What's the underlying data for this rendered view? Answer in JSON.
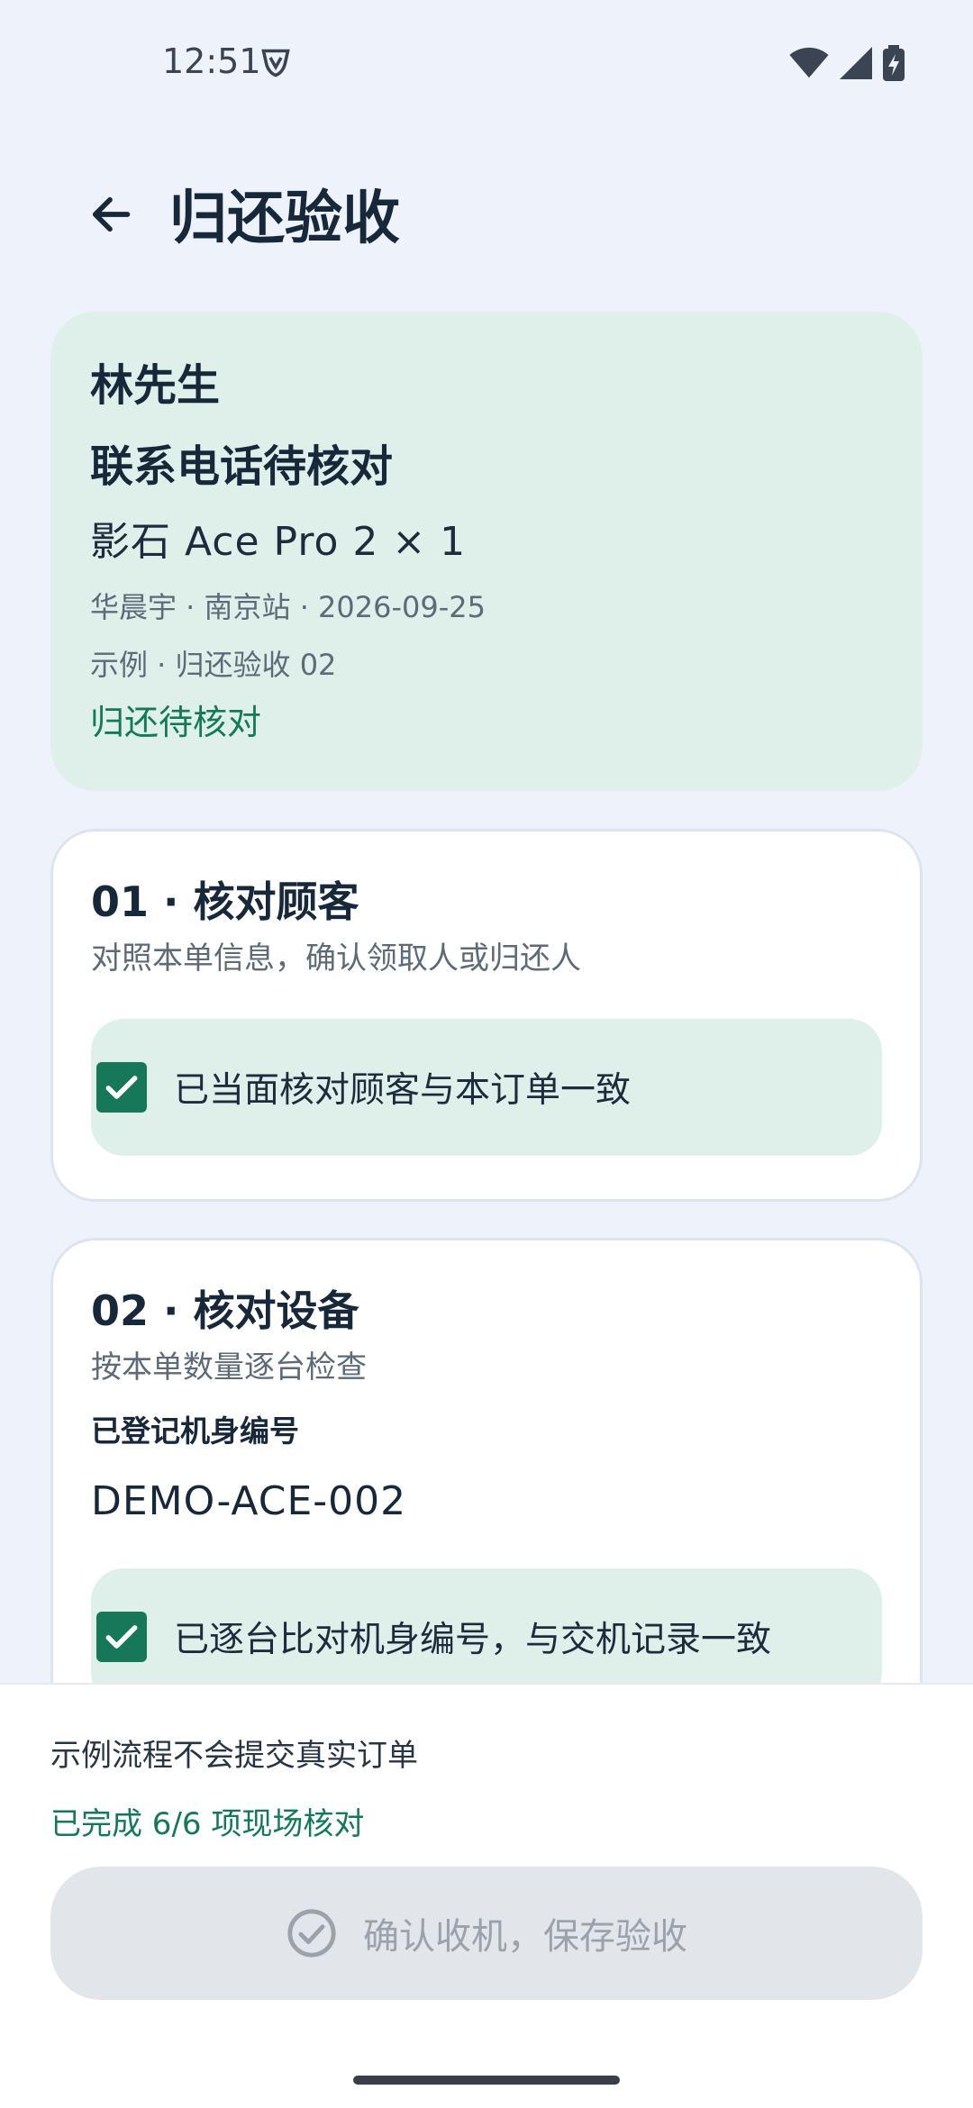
{
  "status_bar": {
    "time": "12:51"
  },
  "app_bar": {
    "title": "归还验收"
  },
  "summary": {
    "customer_name": "林先生",
    "phone": "联系电话待核对",
    "device": "影石 Ace Pro 2 × 1",
    "meta": "华晨宇 · 南京站 · 2026-09-25",
    "example_tag": "示例 · 归还验收 02",
    "status": "归还待核对",
    "status_color": "#137a57",
    "card_color": "#dff0ea"
  },
  "steps": [
    {
      "title": "01 · 核对顾客",
      "subtitle": "对照本单信息，确认领取人或归还人",
      "checkbox_label": "已当面核对顾客与本订单一致",
      "checked": true
    },
    {
      "title": "02 · 核对设备",
      "subtitle": "按本单数量逐台检查",
      "serial_label": "已登记机身编号",
      "serial_value": "DEMO-ACE-002",
      "checkbox_label": "已逐台比对机身编号，与交机记录一致",
      "checked": true
    }
  ],
  "bottom": {
    "notice": "示例流程不会提交真实订单",
    "progress": "已完成 6/6 项现场核对",
    "confirm_label": "确认收机，保存验收",
    "confirm_enabled": false
  },
  "colors": {
    "background": "#eef2fa",
    "accent": "#177859",
    "text": "#17283a"
  },
  "icons": {
    "back": "arrow-left-icon",
    "shield": "vpn-shield-icon",
    "wifi": "wifi-icon",
    "signal": "cell-signal-icon",
    "battery": "battery-charging-icon",
    "check": "check-icon",
    "confirm": "check-circle-icon"
  }
}
